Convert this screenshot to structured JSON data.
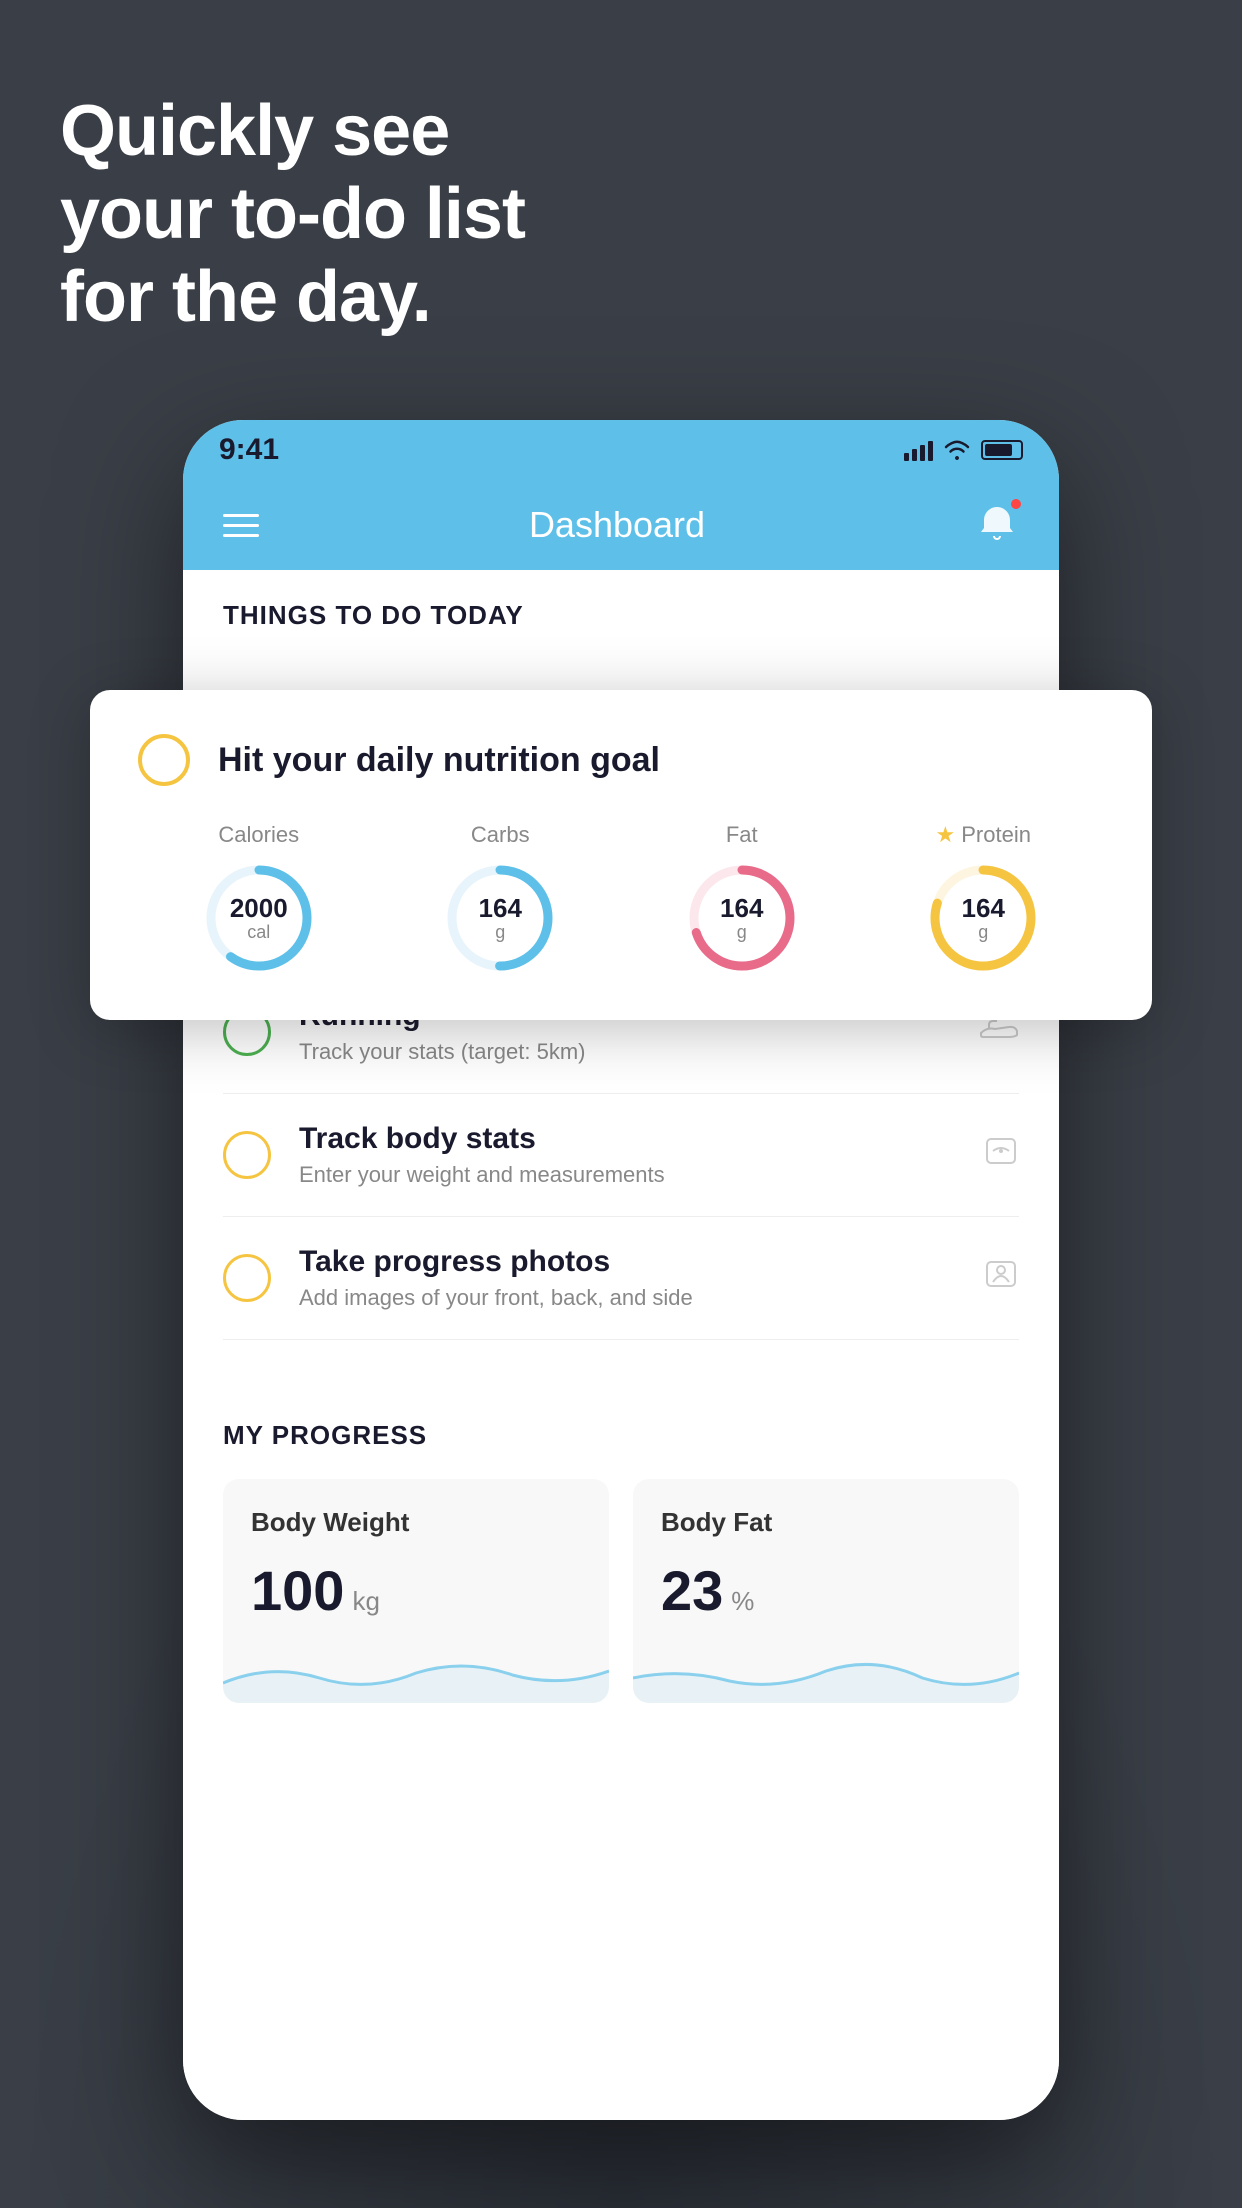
{
  "hero": {
    "line1": "Quickly see",
    "line2": "your to-do list",
    "line3": "for the day."
  },
  "phone": {
    "statusBar": {
      "time": "9:41"
    },
    "navBar": {
      "title": "Dashboard"
    },
    "sectionHeader": "THINGS TO DO TODAY",
    "floatingCard": {
      "checkColor": "#f5c542",
      "title": "Hit your daily nutrition goal",
      "nutrition": [
        {
          "label": "Calories",
          "value": "2000",
          "unit": "cal",
          "color": "#5ec0e8",
          "progress": 60
        },
        {
          "label": "Carbs",
          "value": "164",
          "unit": "g",
          "color": "#5ec0e8",
          "progress": 50
        },
        {
          "label": "Fat",
          "value": "164",
          "unit": "g",
          "color": "#e86b8a",
          "progress": 70
        },
        {
          "label": "Protein",
          "value": "164",
          "unit": "g",
          "color": "#f5c542",
          "progress": 80,
          "starred": true
        }
      ]
    },
    "todoItems": [
      {
        "id": "running",
        "circleColor": "green",
        "title": "Running",
        "subtitle": "Track your stats (target: 5km)",
        "icon": "shoe"
      },
      {
        "id": "track-body",
        "circleColor": "yellow",
        "title": "Track body stats",
        "subtitle": "Enter your weight and measurements",
        "icon": "scale"
      },
      {
        "id": "progress-photos",
        "circleColor": "yellow",
        "title": "Take progress photos",
        "subtitle": "Add images of your front, back, and side",
        "icon": "person"
      }
    ],
    "progressSection": {
      "header": "MY PROGRESS",
      "cards": [
        {
          "id": "body-weight",
          "title": "Body Weight",
          "value": "100",
          "unit": "kg"
        },
        {
          "id": "body-fat",
          "title": "Body Fat",
          "value": "23",
          "unit": "%"
        }
      ]
    }
  },
  "colors": {
    "headerBg": "#5ec0e8",
    "pageBg": "#3a3f47",
    "cardBg": "#ffffff",
    "accentYellow": "#f5c542",
    "accentGreen": "#4caf50",
    "accentBlue": "#5ec0e8",
    "accentPink": "#e86b8a"
  }
}
